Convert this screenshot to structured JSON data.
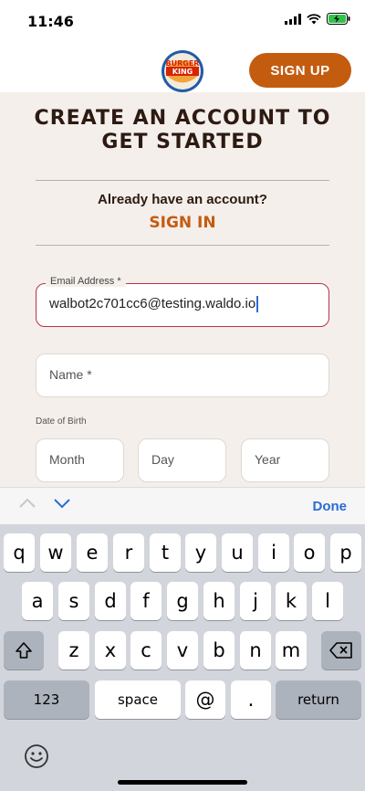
{
  "status": {
    "time": "11:46"
  },
  "header": {
    "logo_text": [
      "BURGER",
      "KING"
    ],
    "signup_label": "SIGN UP"
  },
  "form": {
    "title": "CREATE AN ACCOUNT TO GET STARTED",
    "have_account": "Already have an account?",
    "signin_label": "SIGN IN",
    "email": {
      "label": "Email Address *",
      "value": "walbot2c701cc6@testing.waldo.io"
    },
    "name": {
      "placeholder": "Name *"
    },
    "dob": {
      "label": "Date of Birth",
      "month": "Month",
      "day": "Day",
      "year": "Year"
    }
  },
  "keyboard_accessory": {
    "done_label": "Done"
  },
  "keyboard": {
    "row1": [
      "q",
      "w",
      "e",
      "r",
      "t",
      "y",
      "u",
      "i",
      "o",
      "p"
    ],
    "row2": [
      "a",
      "s",
      "d",
      "f",
      "g",
      "h",
      "j",
      "k",
      "l"
    ],
    "row3": [
      "z",
      "x",
      "c",
      "v",
      "b",
      "n",
      "m"
    ],
    "numbers_label": "123",
    "space_label": "space",
    "at_label": "@",
    "dot_label": ".",
    "return_label": "return"
  },
  "colors": {
    "brand_orange": "#c45c10",
    "active_border": "#b5334b",
    "link_blue": "#2b6bd6"
  }
}
